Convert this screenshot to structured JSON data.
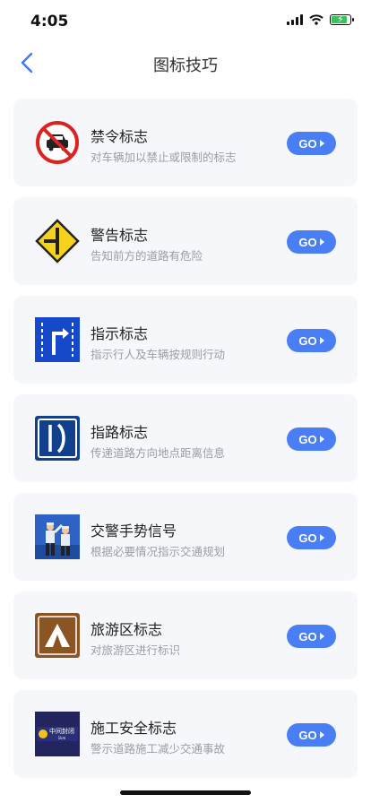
{
  "status_bar": {
    "time": "4:05"
  },
  "header": {
    "title": "图标技巧"
  },
  "cards": [
    {
      "title": "禁令标志",
      "desc": "对车辆加以禁止或限制的标志",
      "button": "GO",
      "icon": "no-cars-sign-icon"
    },
    {
      "title": "警告标志",
      "desc": "告知前方的道路有危险",
      "button": "GO",
      "icon": "t-junction-warning-sign-icon"
    },
    {
      "title": "指示标志",
      "desc": "指示行人及车辆按规则行动",
      "button": "GO",
      "icon": "lane-turn-right-sign-icon"
    },
    {
      "title": "指路标志",
      "desc": "传递道路方向地点距离信息",
      "button": "GO",
      "icon": "road-guide-sign-icon"
    },
    {
      "title": "交警手势信号",
      "desc": "根据必要情况指示交通规划",
      "button": "GO",
      "icon": "traffic-police-gesture-icon"
    },
    {
      "title": "旅游区标志",
      "desc": "对旅游区进行标识",
      "button": "GO",
      "icon": "camping-tent-sign-icon"
    },
    {
      "title": "施工安全标志",
      "desc": "警示道路施工减少交通事故",
      "button": "GO",
      "icon": "road-closure-sign-icon"
    }
  ],
  "icon_text": {
    "closure_sign": "中间封闭",
    "closure_sub": "1km"
  },
  "colors": {
    "accent": "#4a7ef5",
    "card_bg": "#f6f7fb",
    "desc_text": "#9a9da6"
  }
}
